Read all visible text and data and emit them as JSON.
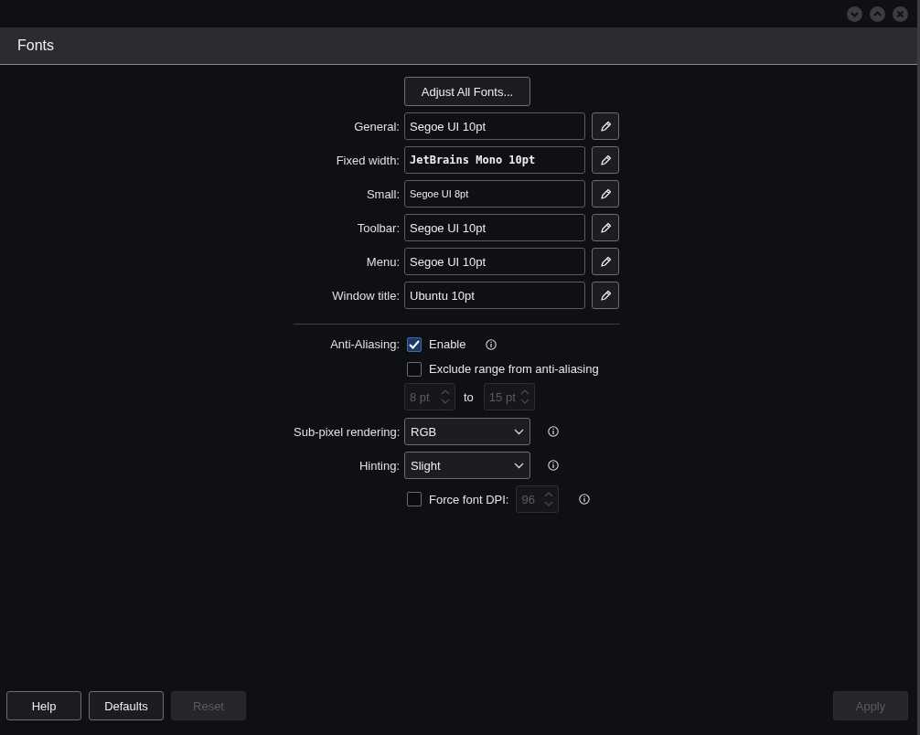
{
  "window": {
    "title": "Fonts"
  },
  "adjust_button": "Adjust All Fonts...",
  "fonts": [
    {
      "label": "General:",
      "value": "Segoe UI 10pt",
      "kind": "sans"
    },
    {
      "label": "Fixed width:",
      "value": "JetBrains Mono 10pt",
      "kind": "mono"
    },
    {
      "label": "Small:",
      "value": "Segoe UI 8pt",
      "kind": "small"
    },
    {
      "label": "Toolbar:",
      "value": "Segoe UI 10pt",
      "kind": "sans"
    },
    {
      "label": "Menu:",
      "value": "Segoe UI 10pt",
      "kind": "sans"
    },
    {
      "label": "Window title:",
      "value": "Ubuntu 10pt",
      "kind": "sans"
    }
  ],
  "anti_aliasing": {
    "label": "Anti-Aliasing:",
    "enable": {
      "label": "Enable",
      "checked": true
    },
    "exclude": {
      "label": "Exclude range from anti-aliasing",
      "checked": false
    },
    "range_from": {
      "value": "8 pt",
      "disabled": true
    },
    "range_to_label": "to",
    "range_to": {
      "value": "15 pt",
      "disabled": true
    }
  },
  "subpixel": {
    "label": "Sub-pixel rendering:",
    "value": "RGB"
  },
  "hinting": {
    "label": "Hinting:",
    "value": "Slight"
  },
  "force_dpi": {
    "label": "Force font DPI:",
    "checked": false,
    "value": "96",
    "disabled": true
  },
  "left_buttons": [
    {
      "label": "Help",
      "disabled": false
    },
    {
      "label": "Defaults",
      "disabled": false
    },
    {
      "label": "Reset",
      "disabled": true
    }
  ],
  "right_buttons": [
    {
      "label": "Apply",
      "disabled": true
    }
  ]
}
